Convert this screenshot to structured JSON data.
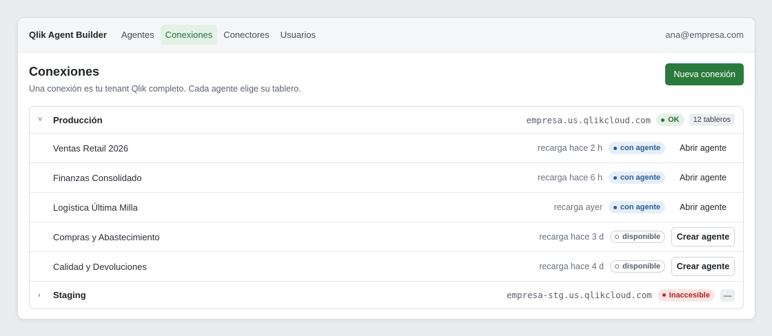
{
  "app": {
    "title": "Qlik Agent Builder",
    "user": "ana@empresa.com"
  },
  "nav": [
    {
      "label": "Agentes",
      "active": false
    },
    {
      "label": "Conexiones",
      "active": true
    },
    {
      "label": "Conectores",
      "active": false
    },
    {
      "label": "Usuarios",
      "active": false
    }
  ],
  "page": {
    "title": "Conexiones",
    "subtitle": "Una conexión es tu tenant Qlik completo. Cada agente elige su tablero.",
    "primary_action": "Nueva conexión"
  },
  "connections": [
    {
      "name": "Producción",
      "host": "empresa.us.qlikcloud.com",
      "status": "OK",
      "count": "12 tableros",
      "expanded": true,
      "chevron": "˅",
      "apps": [
        {
          "name": "Ventas Retail 2026",
          "reload": "recarga hace 2 h",
          "state": "con agente",
          "action": "Abrir agente"
        },
        {
          "name": "Finanzas Consolidado",
          "reload": "recarga hace 6 h",
          "state": "con agente",
          "action": "Abrir agente"
        },
        {
          "name": "Logística Última Milla",
          "reload": "recarga ayer",
          "state": "con agente",
          "action": "Abrir agente"
        },
        {
          "name": "Compras y Abastecimiento",
          "reload": "recarga hace 3 d",
          "state": "disponible",
          "action": "Crear agente"
        },
        {
          "name": "Calidad y Devoluciones",
          "reload": "recarga hace 4 d",
          "state": "disponible",
          "action": "Crear agente"
        }
      ]
    },
    {
      "name": "Staging",
      "host": "empresa-stg.us.qlikcloud.com",
      "status": "Inaccesible",
      "count": "—",
      "expanded": false,
      "chevron": "›"
    }
  ],
  "colors": {
    "accent": "#2b7a3d",
    "ok": "#27743f",
    "error": "#c62828",
    "agent": "#2d5d99"
  }
}
